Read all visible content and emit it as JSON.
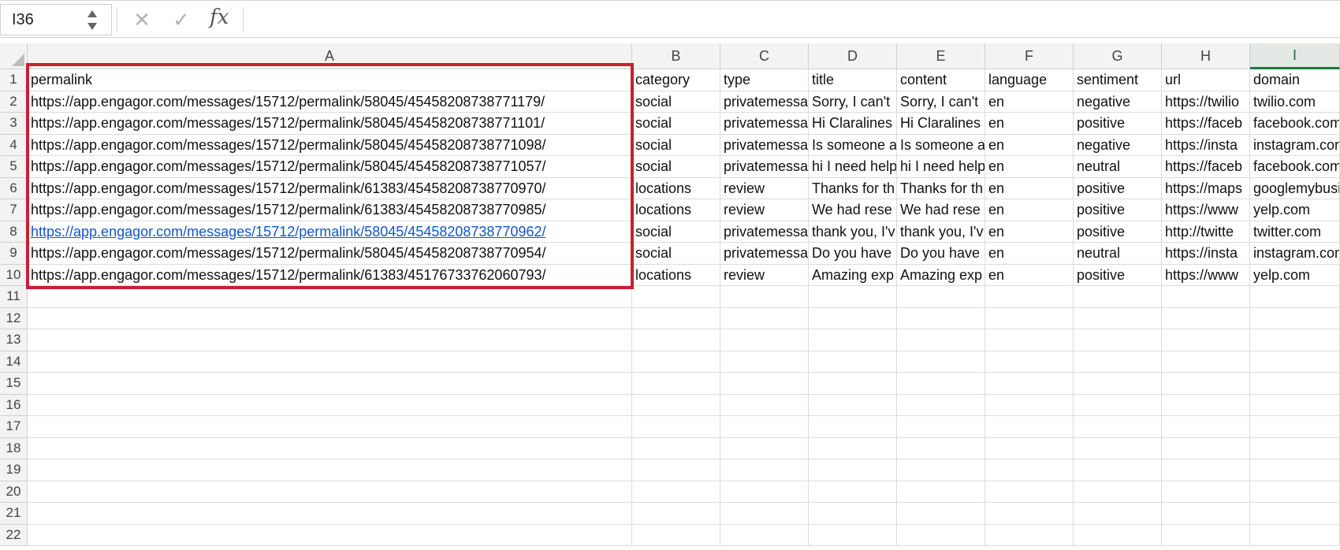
{
  "formula_bar": {
    "name_box": "I36",
    "cancel_icon": "close-icon",
    "enter_icon": "check-icon",
    "fx_label": "fx",
    "formula": ""
  },
  "columns": [
    "A",
    "B",
    "C",
    "D",
    "E",
    "F",
    "G",
    "H",
    "I"
  ],
  "active_column": "I",
  "row_numbers": [
    "1",
    "2",
    "3",
    "4",
    "5",
    "6",
    "7",
    "8",
    "9",
    "10",
    "11",
    "12",
    "13",
    "14",
    "15",
    "16",
    "17",
    "18",
    "19",
    "20",
    "21",
    "22"
  ],
  "rows": [
    [
      "permalink",
      "category",
      "type",
      "title",
      "content",
      "language",
      "sentiment",
      "url",
      "domain"
    ],
    [
      "https://app.engagor.com/messages/15712/permalink/58045/45458208738771179/",
      "social",
      "privatemessage",
      "Sorry, I can't",
      "Sorry, I can't",
      "en",
      "negative",
      "https://twilio",
      "twilio.com"
    ],
    [
      "https://app.engagor.com/messages/15712/permalink/58045/45458208738771101/",
      "social",
      "privatemessage",
      "Hi Claralines",
      "Hi Claralines",
      "en",
      "positive",
      "https://faceb",
      "facebook.com"
    ],
    [
      "https://app.engagor.com/messages/15712/permalink/58045/45458208738771098/",
      "social",
      "privatemessage",
      "Is someone a",
      "Is someone a",
      "en",
      "negative",
      "https://insta",
      "instagram.com"
    ],
    [
      "https://app.engagor.com/messages/15712/permalink/58045/45458208738771057/",
      "social",
      "privatemessage",
      "hi I need help",
      "hi I need help",
      "en",
      "neutral",
      "https://faceb",
      "facebook.com"
    ],
    [
      "https://app.engagor.com/messages/15712/permalink/61383/45458208738770970/",
      "locations",
      "review",
      "Thanks for th",
      "Thanks for th",
      "en",
      "positive",
      "https://maps",
      "googlemybusiness"
    ],
    [
      "https://app.engagor.com/messages/15712/permalink/61383/45458208738770985/",
      "locations",
      "review",
      "We had rese",
      "We had rese",
      "en",
      "positive",
      "https://www",
      "yelp.com"
    ],
    [
      "https://app.engagor.com/messages/15712/permalink/58045/45458208738770962/",
      "social",
      "privatemessage",
      "thank you, I'v",
      "thank you, I'v",
      "en",
      "positive",
      "http://twitte",
      "twitter.com"
    ],
    [
      "https://app.engagor.com/messages/15712/permalink/58045/45458208738770954/",
      "social",
      "privatemessage",
      "Do you have",
      "Do you have",
      "en",
      "neutral",
      "https://insta",
      "instagram.com"
    ],
    [
      "https://app.engagor.com/messages/15712/permalink/61383/45176733762060793/",
      "locations",
      "review",
      "Amazing exp",
      "Amazing exp",
      "en",
      "positive",
      "https://www",
      "yelp.com"
    ]
  ],
  "link_cell": {
    "row": 8,
    "col": "A"
  }
}
